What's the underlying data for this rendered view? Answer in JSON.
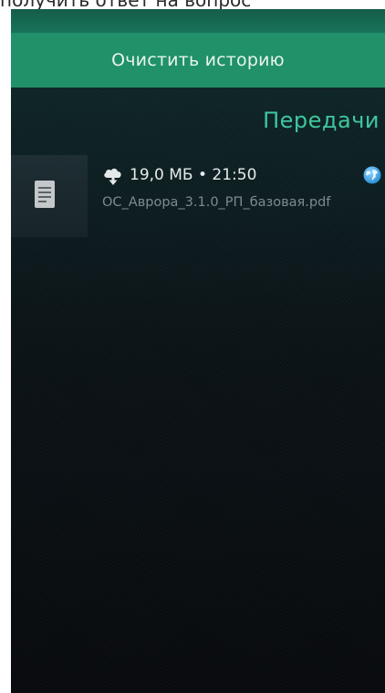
{
  "top_strip": {
    "clipped_text": "получить ответ на вопрос"
  },
  "header": {
    "clear_history_label": "Очистить историю",
    "page_title": "Передачи"
  },
  "transfers": [
    {
      "meta": "19,0 МБ • 21:50",
      "filename": "ОС_Аврора_3.1.0_РП_базовая.pdf",
      "direction_icon": "cloud-download-icon",
      "status_icon": "globe-icon",
      "file_icon": "document-icon"
    }
  ],
  "colors": {
    "accent": "#209168",
    "title": "#3fc7a0",
    "background": "#0a1216"
  }
}
